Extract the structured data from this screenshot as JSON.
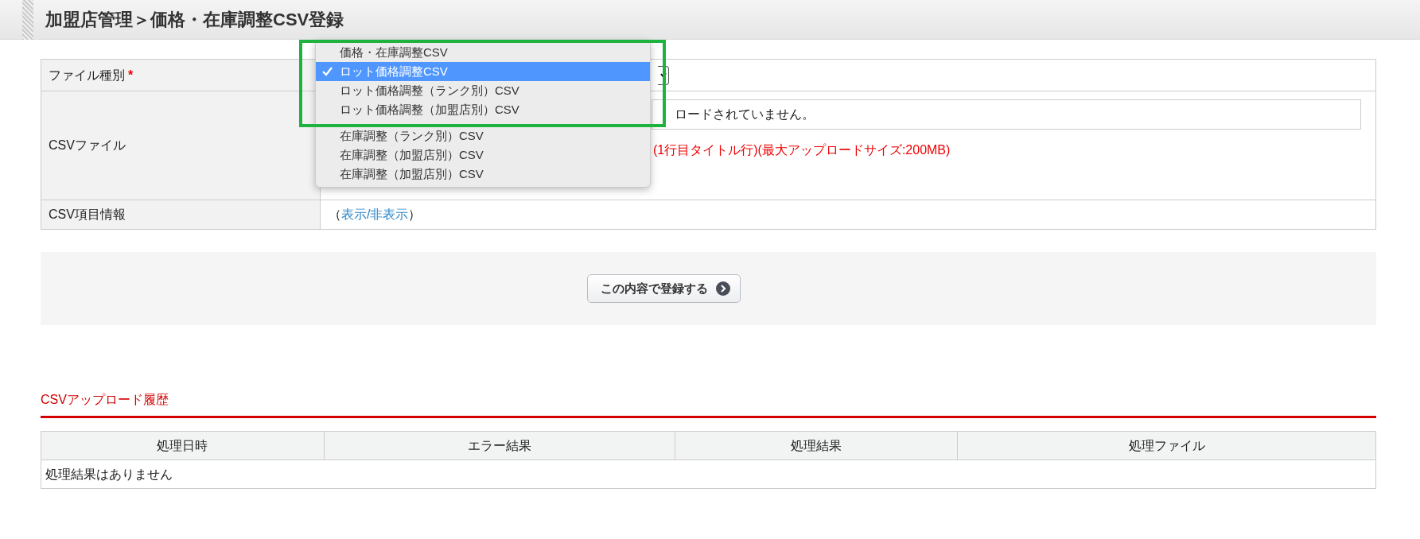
{
  "header": {
    "title": "加盟店管理＞価格・在庫調整CSV登録"
  },
  "form": {
    "rows": [
      {
        "kind": "select",
        "label": "ファイル種別",
        "required_mark": "*"
      },
      {
        "kind": "file",
        "label": "CSVファイル",
        "value": "ロードされていません。",
        "note": "(1行目タイトル行)(最大アップロードサイズ:200MB)"
      },
      {
        "kind": "toggle",
        "label": "CSV項目情報",
        "prefix": "（",
        "link": "表示/非表示",
        "suffix": "）"
      }
    ]
  },
  "dropdown": {
    "options": [
      {
        "label": "価格・在庫調整CSV",
        "selected": false
      },
      {
        "label": "ロット価格調整CSV",
        "selected": true
      },
      {
        "label": "ロット価格調整（ランク別）CSV",
        "selected": false
      },
      {
        "label": "ロット価格調整（加盟店別）CSV",
        "selected": false
      },
      {
        "label": "在庫調整（ランク別）CSV",
        "selected": false
      },
      {
        "label": "在庫調整（加盟店別）CSV",
        "selected": false
      },
      {
        "label": "在庫調整（加盟店別）CSV",
        "selected": false
      }
    ]
  },
  "submit_button": {
    "label": "この内容で登録する"
  },
  "history": {
    "title": "CSVアップロード履歴",
    "columns": [
      "処理日時",
      "エラー結果",
      "処理結果",
      "処理ファイル"
    ],
    "empty_message": "処理結果はありません"
  }
}
